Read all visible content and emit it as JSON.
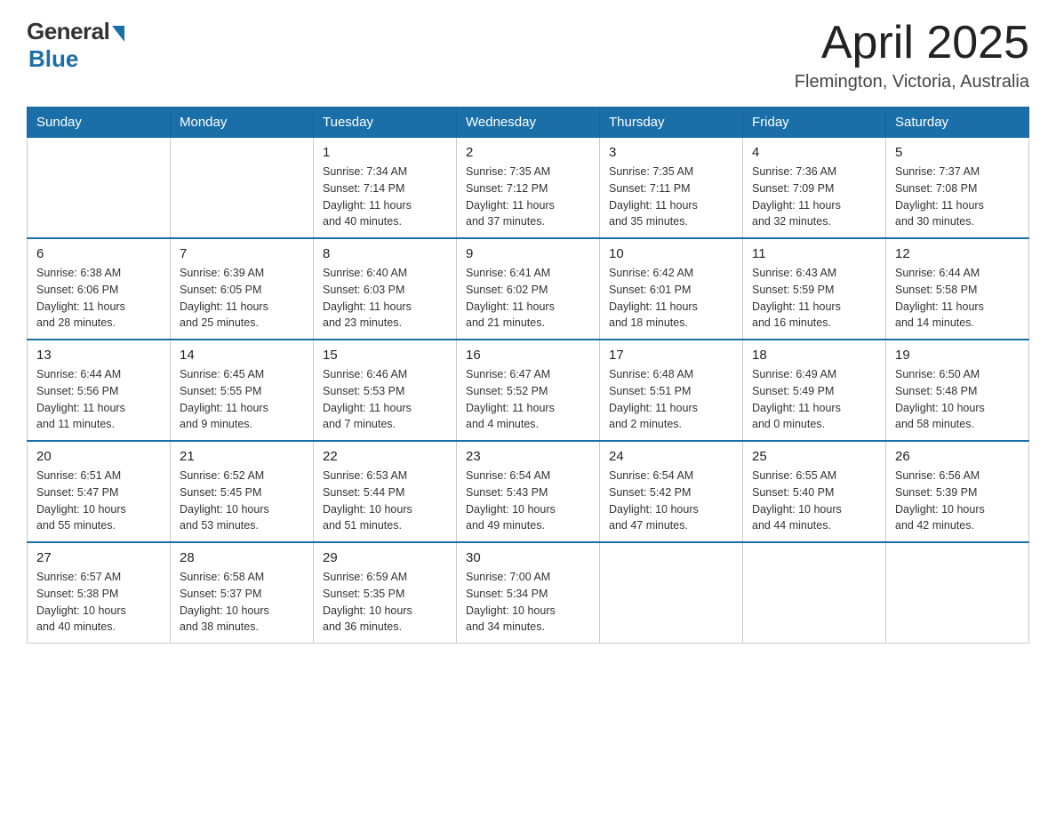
{
  "logo": {
    "general": "General",
    "blue": "Blue"
  },
  "title": "April 2025",
  "location": "Flemington, Victoria, Australia",
  "headers": [
    "Sunday",
    "Monday",
    "Tuesday",
    "Wednesday",
    "Thursday",
    "Friday",
    "Saturday"
  ],
  "weeks": [
    [
      {
        "day": "",
        "info": ""
      },
      {
        "day": "",
        "info": ""
      },
      {
        "day": "1",
        "info": "Sunrise: 7:34 AM\nSunset: 7:14 PM\nDaylight: 11 hours\nand 40 minutes."
      },
      {
        "day": "2",
        "info": "Sunrise: 7:35 AM\nSunset: 7:12 PM\nDaylight: 11 hours\nand 37 minutes."
      },
      {
        "day": "3",
        "info": "Sunrise: 7:35 AM\nSunset: 7:11 PM\nDaylight: 11 hours\nand 35 minutes."
      },
      {
        "day": "4",
        "info": "Sunrise: 7:36 AM\nSunset: 7:09 PM\nDaylight: 11 hours\nand 32 minutes."
      },
      {
        "day": "5",
        "info": "Sunrise: 7:37 AM\nSunset: 7:08 PM\nDaylight: 11 hours\nand 30 minutes."
      }
    ],
    [
      {
        "day": "6",
        "info": "Sunrise: 6:38 AM\nSunset: 6:06 PM\nDaylight: 11 hours\nand 28 minutes."
      },
      {
        "day": "7",
        "info": "Sunrise: 6:39 AM\nSunset: 6:05 PM\nDaylight: 11 hours\nand 25 minutes."
      },
      {
        "day": "8",
        "info": "Sunrise: 6:40 AM\nSunset: 6:03 PM\nDaylight: 11 hours\nand 23 minutes."
      },
      {
        "day": "9",
        "info": "Sunrise: 6:41 AM\nSunset: 6:02 PM\nDaylight: 11 hours\nand 21 minutes."
      },
      {
        "day": "10",
        "info": "Sunrise: 6:42 AM\nSunset: 6:01 PM\nDaylight: 11 hours\nand 18 minutes."
      },
      {
        "day": "11",
        "info": "Sunrise: 6:43 AM\nSunset: 5:59 PM\nDaylight: 11 hours\nand 16 minutes."
      },
      {
        "day": "12",
        "info": "Sunrise: 6:44 AM\nSunset: 5:58 PM\nDaylight: 11 hours\nand 14 minutes."
      }
    ],
    [
      {
        "day": "13",
        "info": "Sunrise: 6:44 AM\nSunset: 5:56 PM\nDaylight: 11 hours\nand 11 minutes."
      },
      {
        "day": "14",
        "info": "Sunrise: 6:45 AM\nSunset: 5:55 PM\nDaylight: 11 hours\nand 9 minutes."
      },
      {
        "day": "15",
        "info": "Sunrise: 6:46 AM\nSunset: 5:53 PM\nDaylight: 11 hours\nand 7 minutes."
      },
      {
        "day": "16",
        "info": "Sunrise: 6:47 AM\nSunset: 5:52 PM\nDaylight: 11 hours\nand 4 minutes."
      },
      {
        "day": "17",
        "info": "Sunrise: 6:48 AM\nSunset: 5:51 PM\nDaylight: 11 hours\nand 2 minutes."
      },
      {
        "day": "18",
        "info": "Sunrise: 6:49 AM\nSunset: 5:49 PM\nDaylight: 11 hours\nand 0 minutes."
      },
      {
        "day": "19",
        "info": "Sunrise: 6:50 AM\nSunset: 5:48 PM\nDaylight: 10 hours\nand 58 minutes."
      }
    ],
    [
      {
        "day": "20",
        "info": "Sunrise: 6:51 AM\nSunset: 5:47 PM\nDaylight: 10 hours\nand 55 minutes."
      },
      {
        "day": "21",
        "info": "Sunrise: 6:52 AM\nSunset: 5:45 PM\nDaylight: 10 hours\nand 53 minutes."
      },
      {
        "day": "22",
        "info": "Sunrise: 6:53 AM\nSunset: 5:44 PM\nDaylight: 10 hours\nand 51 minutes."
      },
      {
        "day": "23",
        "info": "Sunrise: 6:54 AM\nSunset: 5:43 PM\nDaylight: 10 hours\nand 49 minutes."
      },
      {
        "day": "24",
        "info": "Sunrise: 6:54 AM\nSunset: 5:42 PM\nDaylight: 10 hours\nand 47 minutes."
      },
      {
        "day": "25",
        "info": "Sunrise: 6:55 AM\nSunset: 5:40 PM\nDaylight: 10 hours\nand 44 minutes."
      },
      {
        "day": "26",
        "info": "Sunrise: 6:56 AM\nSunset: 5:39 PM\nDaylight: 10 hours\nand 42 minutes."
      }
    ],
    [
      {
        "day": "27",
        "info": "Sunrise: 6:57 AM\nSunset: 5:38 PM\nDaylight: 10 hours\nand 40 minutes."
      },
      {
        "day": "28",
        "info": "Sunrise: 6:58 AM\nSunset: 5:37 PM\nDaylight: 10 hours\nand 38 minutes."
      },
      {
        "day": "29",
        "info": "Sunrise: 6:59 AM\nSunset: 5:35 PM\nDaylight: 10 hours\nand 36 minutes."
      },
      {
        "day": "30",
        "info": "Sunrise: 7:00 AM\nSunset: 5:34 PM\nDaylight: 10 hours\nand 34 minutes."
      },
      {
        "day": "",
        "info": ""
      },
      {
        "day": "",
        "info": ""
      },
      {
        "day": "",
        "info": ""
      }
    ]
  ]
}
